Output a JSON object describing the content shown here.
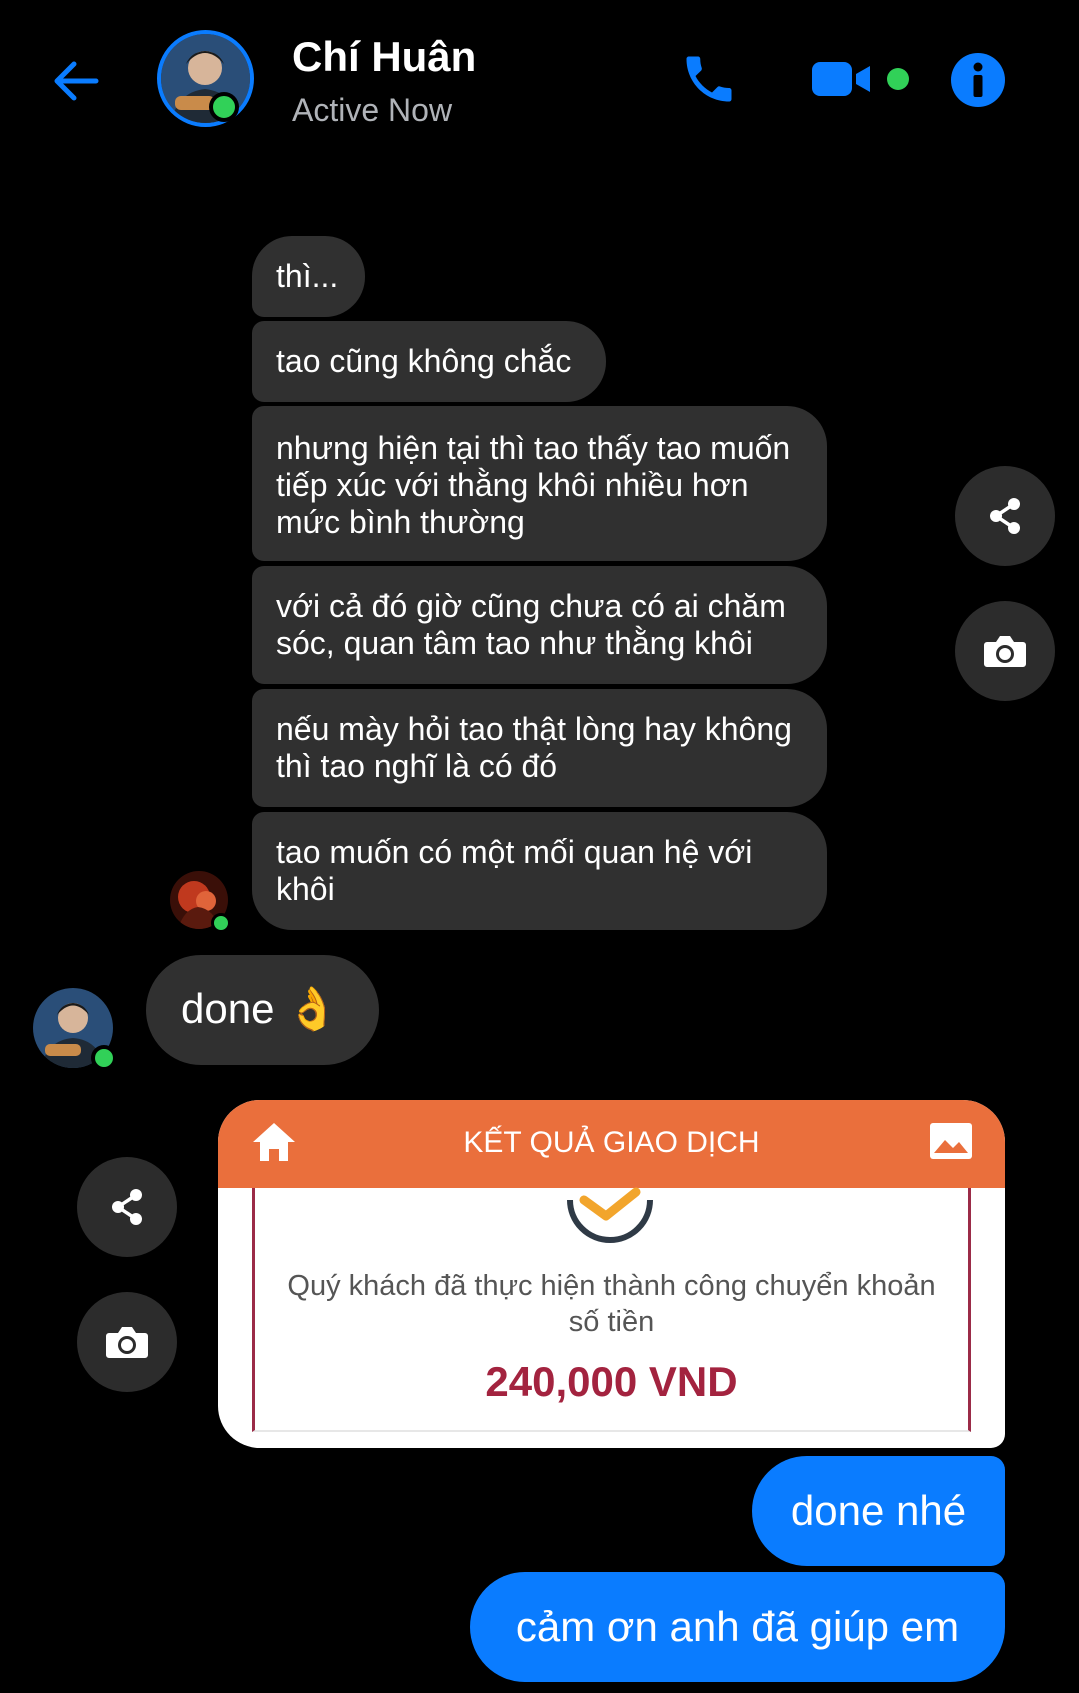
{
  "header": {
    "contact_name": "Chí Huân",
    "status": "Active Now",
    "icons": [
      "back-arrow-icon",
      "phone-icon",
      "video-camera-icon",
      "info-icon"
    ],
    "accent_color": "#0a7cff",
    "online_color": "#31d158"
  },
  "messages_incoming": [
    "thì...",
    "tao cũng không chắc",
    "nhưng hiện tại thì tao thấy tao muốn tiếp xúc với thằng khôi nhiều hơn mức bình thường",
    "với cả đó giờ cũng chưa có ai chăm sóc, quan tâm tao như thằng khôi",
    "nếu mày hỏi tao thật lòng hay không thì tao nghĩ là có đó",
    "tao muốn có một mối quan hệ với khôi"
  ],
  "message_done": "done 👌",
  "transaction_card": {
    "title": "KẾT QUẢ GIAO DỊCH",
    "message": "Quý khách đã thực hiện thành công chuyển khoản số tiền",
    "amount": "240,000 VND",
    "header_color": "#ea6f3c"
  },
  "messages_outgoing": [
    "done nhé",
    "cảm ơn anh đã giúp em"
  ]
}
